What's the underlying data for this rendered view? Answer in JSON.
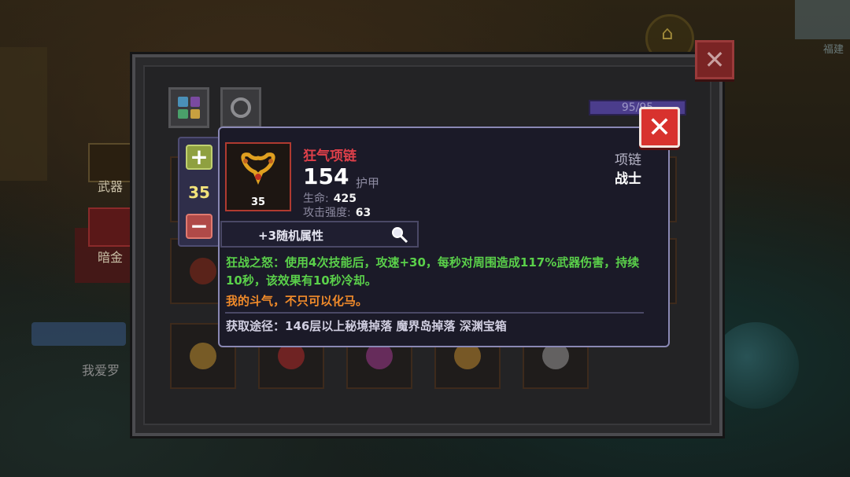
{
  "background": {
    "player_name": "我爱罗",
    "side_buttons": [
      {
        "label": "武器",
        "icon": "weapon-icon"
      },
      {
        "label": "暗金",
        "icon": "dark-gold-icon"
      }
    ],
    "top_right_text": "福建"
  },
  "inventory": {
    "tabs": [
      {
        "name": "bag",
        "icon": "grid-bag-icon"
      },
      {
        "name": "accessories",
        "icon": "ring-icon"
      }
    ],
    "stamina": "95/95"
  },
  "level_adjuster": {
    "plus": "+",
    "value": "35",
    "minus": "−"
  },
  "tooltip": {
    "item_level": "35",
    "name": "狂气项链",
    "armor_value": "154",
    "armor_label": "护甲",
    "stats": [
      {
        "key": "生命:",
        "value": "425"
      },
      {
        "key": "攻击强度:",
        "value": "63"
      }
    ],
    "type": "项链",
    "class": "战士",
    "random_attr": "+3随机属性",
    "effect": "狂战之怒：使用4次技能后，攻速+30，每秒对周围造成117%武器伤害，持续10秒，该效果有10秒冷却。",
    "flavor": "我的斗气，不只可以化马。",
    "source": "获取途径：146层以上秘境掉落 魔界岛掉落 深渊宝箱",
    "close": "✕"
  },
  "main_close": "✕",
  "colors": {
    "item_name": "#e0404a",
    "effect_text": "#5ad04a",
    "flavor_text": "#f08a2a",
    "level_value": "#f2e27a"
  }
}
